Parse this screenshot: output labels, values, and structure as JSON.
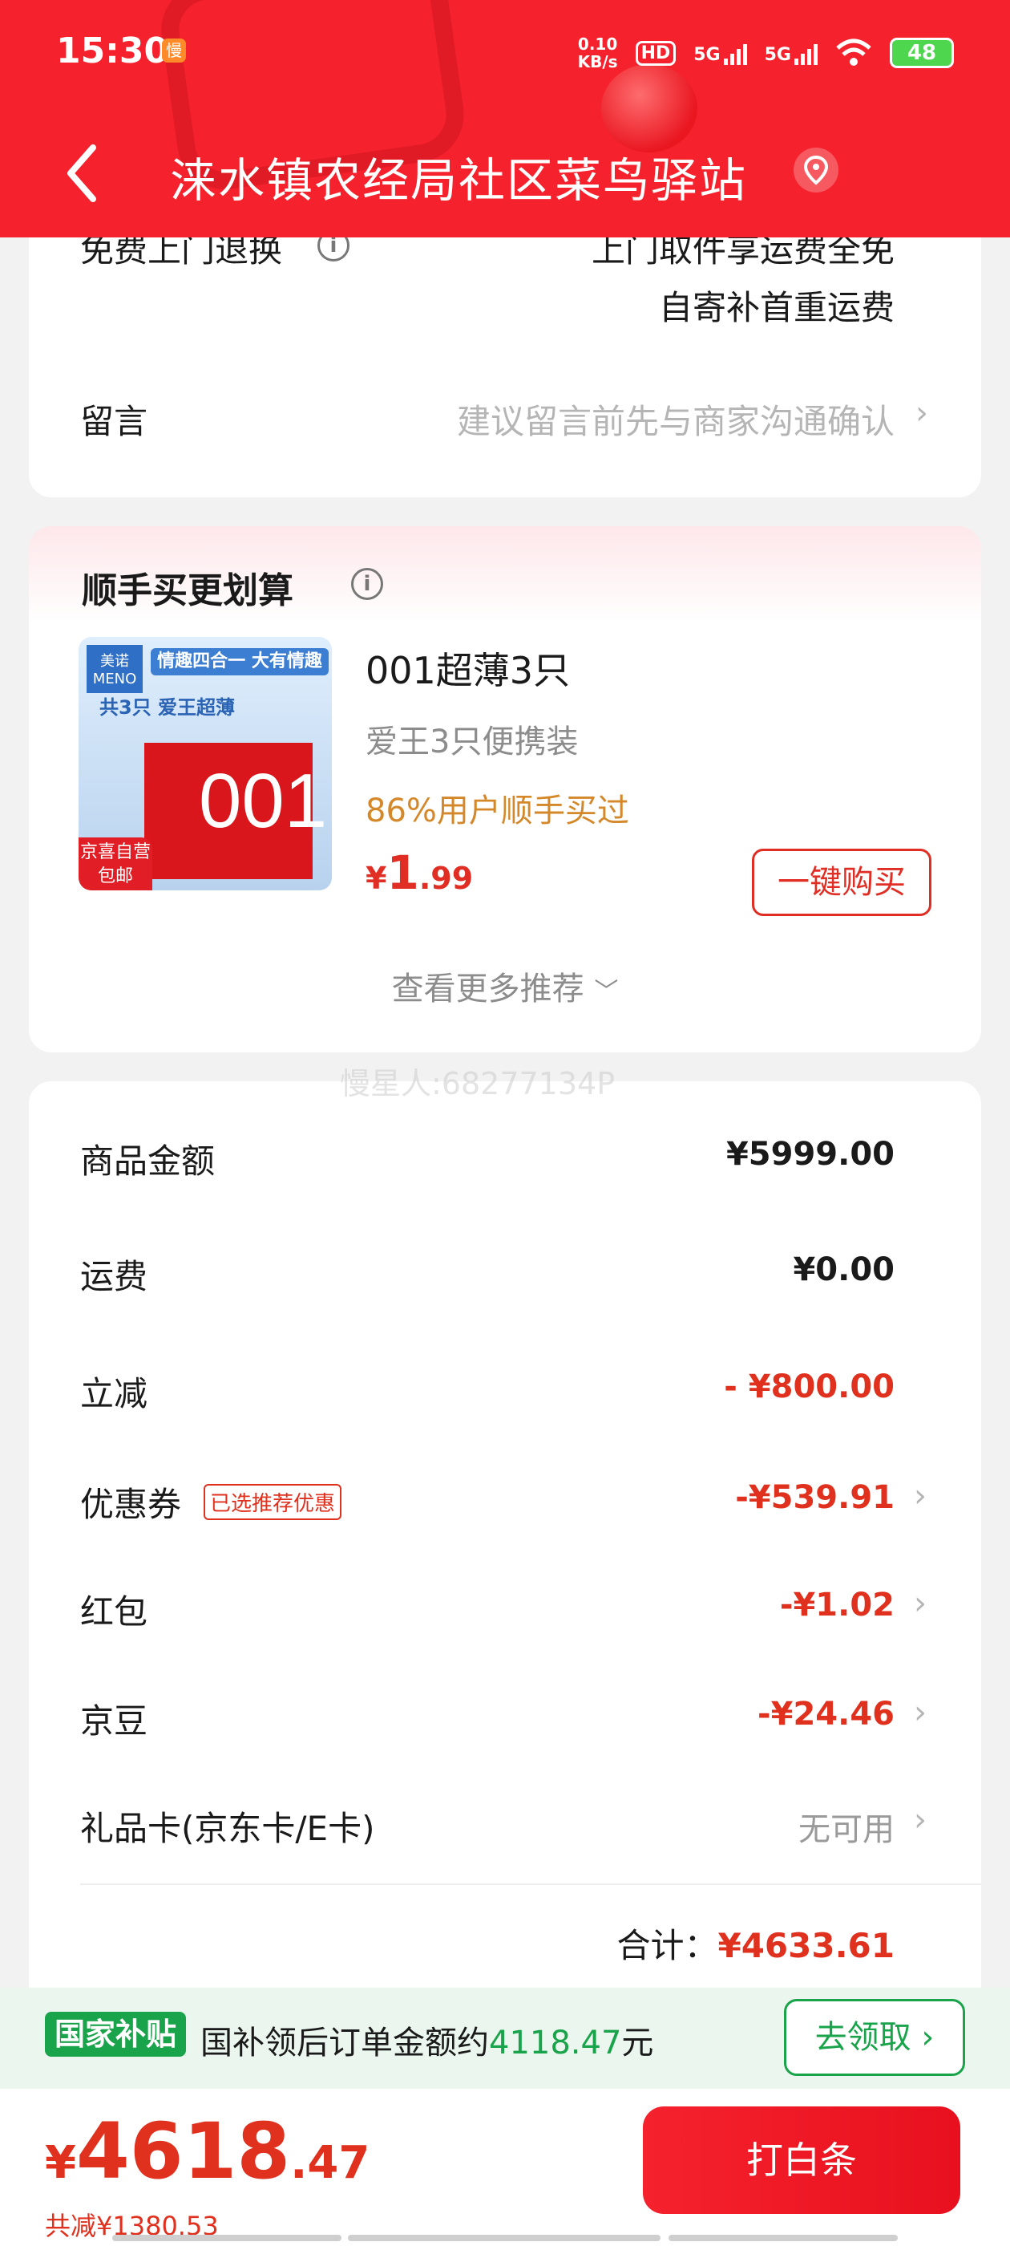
{
  "status_bar": {
    "time": "15:30",
    "app_badge": "慢",
    "net_speed_value": "0.10",
    "net_speed_unit": "KB/s",
    "hd_label": "HD",
    "sim1": "5G",
    "sim2": "5G",
    "battery": "48"
  },
  "nav": {
    "title": "涞水镇农经局社区菜鸟驿站"
  },
  "service": {
    "free_return_label": "免费上门退换",
    "free_return_line1": "上门取件享运费全免",
    "free_return_line2": "自寄补首重运费",
    "message_label": "留言",
    "message_placeholder": "建议留言前先与商家沟通确认"
  },
  "recommend": {
    "title": "顺手买更划算",
    "product": {
      "name": "001超薄3只",
      "desc": "爱王3只便携装",
      "popularity": "86%用户顺手买过",
      "price_currency": "¥",
      "price_int": "1",
      "price_dec": ".99",
      "buy_label": "一键购买",
      "image_banner": "情趣四合一 大有情趣",
      "image_brand": "美诺 MENO",
      "image_sub": "共3只 爱王超薄",
      "image_badge_line1": "京喜自营",
      "image_badge_line2": "包邮",
      "image_box_number": "001"
    },
    "more_label": "查看更多推荐"
  },
  "watermark": "慢星人:68277134P",
  "fees": {
    "rows": [
      {
        "label": "商品金额",
        "value": "¥5999.00"
      },
      {
        "label": "运费",
        "value": "¥0.00"
      },
      {
        "label": "立减",
        "value": "- ¥800.00"
      },
      {
        "label": "优惠券",
        "value": "-¥539.91",
        "tag": "已选推荐优惠"
      },
      {
        "label": "红包",
        "value": "-¥1.02"
      },
      {
        "label": "京豆",
        "value": "-¥24.46"
      },
      {
        "label": "礼品卡(京东卡/E卡)",
        "value": "无可用"
      }
    ],
    "total_label": "合计：",
    "total_value": "¥4633.61"
  },
  "subsidy": {
    "tag": "国家补贴",
    "text_prefix": "国补领后订单金额约",
    "amount": "4118.47",
    "text_suffix": "元",
    "claim_label": "去领取 ›"
  },
  "bottom": {
    "price_currency": "¥",
    "price_int": "4618",
    "price_dec": ".47",
    "saved": "共减¥1380.53",
    "pay_label": "打白条"
  },
  "colors": {
    "brand_red": "#f5222d",
    "price_red": "#e0301e",
    "subsidy_green": "#19a34a",
    "popularity_orange": "#d4882a"
  }
}
